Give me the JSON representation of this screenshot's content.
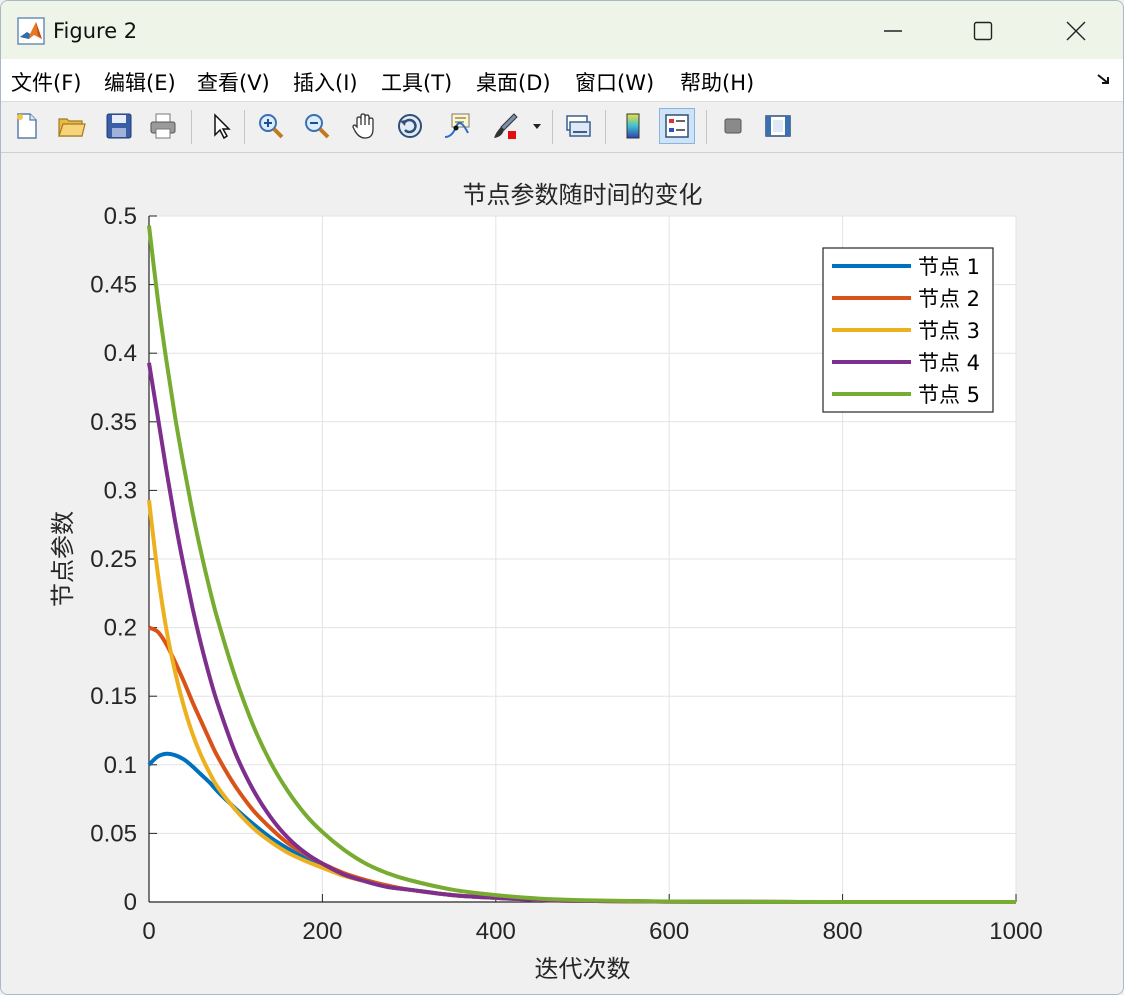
{
  "window": {
    "title": "Figure 2",
    "controls": [
      "minimize",
      "maximize",
      "close"
    ]
  },
  "menu": [
    {
      "label": "文件(F)",
      "name": "menu-file"
    },
    {
      "label": "编辑(E)",
      "name": "menu-edit"
    },
    {
      "label": "查看(V)",
      "name": "menu-view"
    },
    {
      "label": "插入(I)",
      "name": "menu-insert"
    },
    {
      "label": "工具(T)",
      "name": "menu-tools"
    },
    {
      "label": "桌面(D)",
      "name": "menu-desktop"
    },
    {
      "label": "窗口(W)",
      "name": "menu-window"
    },
    {
      "label": "帮助(H)",
      "name": "menu-help"
    }
  ],
  "toolbar": [
    {
      "icon": "new-figure-icon"
    },
    {
      "icon": "open-folder-icon"
    },
    {
      "icon": "save-icon"
    },
    {
      "icon": "print-icon"
    },
    {
      "icon": "pointer-icon"
    },
    {
      "icon": "zoom-in-icon"
    },
    {
      "icon": "zoom-out-icon"
    },
    {
      "icon": "pan-hand-icon"
    },
    {
      "icon": "rotate-3d-icon"
    },
    {
      "icon": "data-cursor-icon"
    },
    {
      "icon": "brush-icon"
    },
    {
      "icon": "link-plot-icon"
    },
    {
      "icon": "colorbar-icon"
    },
    {
      "icon": "legend-icon",
      "active": true
    },
    {
      "icon": "hide-plot-tools-icon"
    },
    {
      "icon": "show-plot-tools-icon"
    }
  ],
  "chart_data": {
    "type": "line",
    "title": "节点参数随时间的变化",
    "xlabel": "迭代次数",
    "ylabel": "节点参数",
    "xlim": [
      0,
      1000
    ],
    "ylim": [
      0,
      0.5
    ],
    "xticks": [
      "0",
      "200",
      "400",
      "600",
      "800",
      "1000"
    ],
    "yticks": [
      "0",
      "0.05",
      "0.1",
      "0.15",
      "0.2",
      "0.25",
      "0.3",
      "0.35",
      "0.4",
      "0.45",
      "0.5"
    ],
    "grid": true,
    "legend_position": "top-right",
    "x": [
      0,
      10,
      20,
      30,
      40,
      50,
      60,
      70,
      80,
      100,
      120,
      140,
      160,
      180,
      200,
      225,
      250,
      275,
      300,
      350,
      400,
      450,
      500,
      600,
      700,
      800,
      900,
      1000
    ],
    "series": [
      {
        "name": "节点 1",
        "color": "#0072BD",
        "values": [
          0.1,
          0.106,
          0.108,
          0.107,
          0.104,
          0.099,
          0.093,
          0.087,
          0.08,
          0.068,
          0.057,
          0.047,
          0.039,
          0.032,
          0.026,
          0.02,
          0.015,
          0.011,
          0.009,
          0.005,
          0.003,
          0.0015,
          0.0008,
          0.0003,
          0.0001,
          0.0,
          0.0,
          0.0
        ]
      },
      {
        "name": "节点 2",
        "color": "#D95319",
        "values": [
          0.2,
          0.197,
          0.188,
          0.175,
          0.161,
          0.146,
          0.132,
          0.118,
          0.105,
          0.084,
          0.067,
          0.054,
          0.043,
          0.035,
          0.028,
          0.021,
          0.016,
          0.012,
          0.009,
          0.005,
          0.003,
          0.0015,
          0.0008,
          0.0003,
          0.0001,
          0.0,
          0.0,
          0.0
        ]
      },
      {
        "name": "节点 3",
        "color": "#EDB120",
        "values": [
          0.293,
          0.24,
          0.199,
          0.168,
          0.143,
          0.123,
          0.107,
          0.094,
          0.083,
          0.067,
          0.054,
          0.044,
          0.036,
          0.03,
          0.025,
          0.019,
          0.015,
          0.011,
          0.009,
          0.005,
          0.003,
          0.0015,
          0.0008,
          0.0003,
          0.0001,
          0.0,
          0.0,
          0.0
        ]
      },
      {
        "name": "节点 4",
        "color": "#7E2F8E",
        "values": [
          0.393,
          0.354,
          0.315,
          0.278,
          0.245,
          0.215,
          0.188,
          0.164,
          0.143,
          0.108,
          0.082,
          0.062,
          0.047,
          0.036,
          0.028,
          0.02,
          0.015,
          0.011,
          0.009,
          0.005,
          0.003,
          0.0015,
          0.0008,
          0.0003,
          0.0001,
          0.0,
          0.0,
          0.0
        ]
      },
      {
        "name": "节点 5",
        "color": "#77AC30",
        "values": [
          0.493,
          0.44,
          0.395,
          0.354,
          0.318,
          0.285,
          0.255,
          0.228,
          0.204,
          0.163,
          0.129,
          0.102,
          0.081,
          0.064,
          0.051,
          0.038,
          0.028,
          0.021,
          0.016,
          0.009,
          0.005,
          0.0025,
          0.0013,
          0.0004,
          0.0001,
          0.0,
          0.0,
          0.0
        ]
      }
    ]
  }
}
